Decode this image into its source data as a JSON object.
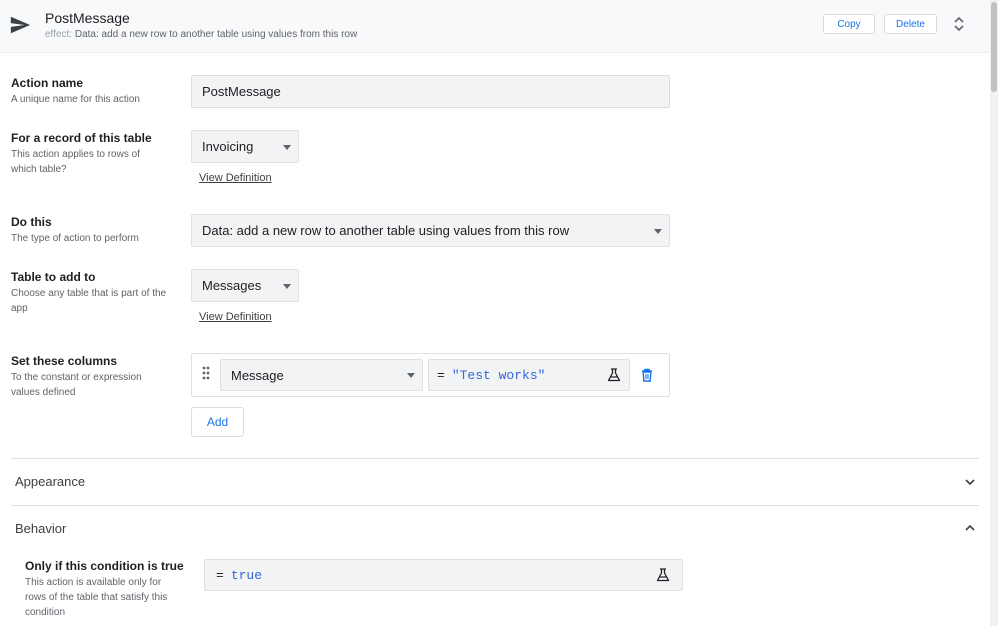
{
  "header": {
    "title": "PostMessage",
    "subtitle_label": "effect:",
    "subtitle_value": "Data: add a new row to another table using values from this row",
    "copy_label": "Copy",
    "delete_label": "Delete"
  },
  "action_name": {
    "title": "Action name",
    "desc": "A unique name for this action",
    "value": "PostMessage"
  },
  "record_table": {
    "title": "For a record of this table",
    "desc_line1": "This action applies to rows of",
    "desc_line2": "which table?",
    "value": "Invoicing",
    "link": "View Definition"
  },
  "do_this": {
    "title": "Do this",
    "desc": "The type of action to perform",
    "value": "Data: add a new row to another table using values from this row"
  },
  "table_add": {
    "title": "Table to add to",
    "desc_line1": "Choose any table that is part of the",
    "desc_line2": "app",
    "value": "Messages",
    "link": "View Definition"
  },
  "set_columns": {
    "title": "Set these columns",
    "desc_line1": "To the constant or expression",
    "desc_line2": "values defined",
    "rows": [
      {
        "column": "Message",
        "eq": "=",
        "expression": "\"Test works\""
      }
    ],
    "add_label": "Add"
  },
  "sections": {
    "appearance": "Appearance",
    "behavior": "Behavior"
  },
  "condition": {
    "title": "Only if this condition is true",
    "desc_line1": "This action is available only for",
    "desc_line2": "rows of the table that satisfy this",
    "desc_line3": "condition",
    "eq": "=",
    "expression": "true"
  },
  "colors": {
    "accent": "#1a73e8",
    "expression": "#3367d6",
    "header_bg": "#f8f9fa",
    "field_bg": "#f1f3f4"
  },
  "icons": {
    "header": "paper-plane-icon",
    "reorder": "unfold-icon",
    "drag": "drag-handle-icon",
    "expression": "flask-icon",
    "delete": "trash-icon",
    "appearance": "chevron-down-icon",
    "behavior": "chevron-up-icon"
  }
}
